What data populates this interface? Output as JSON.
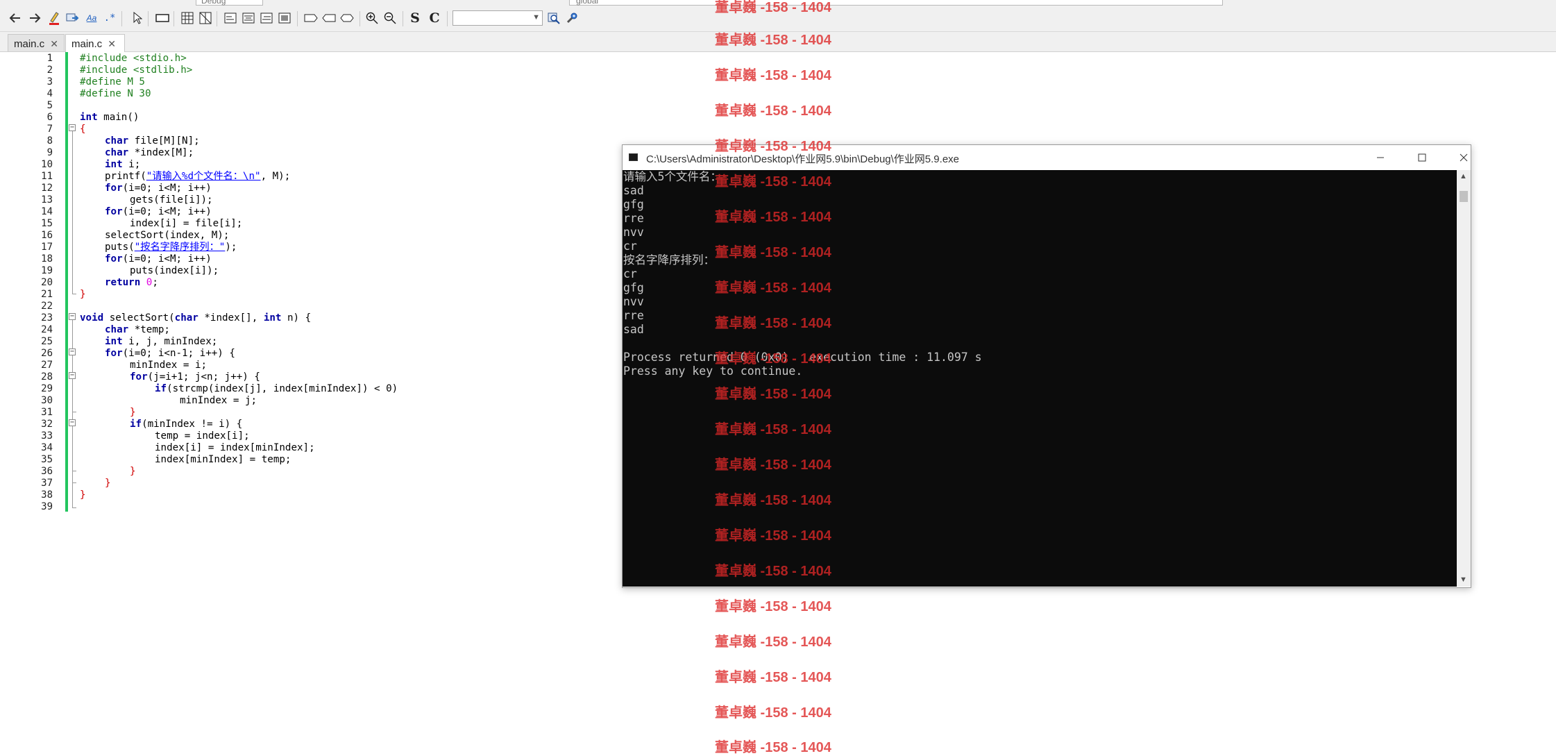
{
  "top_strip": {
    "combo_text": "Debug",
    "scope_text": "global"
  },
  "tabs": [
    {
      "label": "main.c",
      "active": false
    },
    {
      "label": "main.c",
      "active": true
    }
  ],
  "tab_close_glyph": "✕",
  "toolbar": {
    "search_value": "",
    "strike_letter_s": "S",
    "strike_letter_c": "C",
    "icons": [
      "arrow-left-icon",
      "arrow-right-icon",
      "highlight-icon",
      "replace-icon",
      "match-case-icon",
      "regex-icon",
      "pointer-icon",
      "rectangle-icon",
      "table-icon",
      "grid-icon",
      "align-left-icon",
      "align-center-icon",
      "align-right-icon",
      "align-justify-icon",
      "box-icon",
      "box-left-icon",
      "box-right-icon",
      "zoom-in-icon",
      "zoom-out-icon",
      "search-icon",
      "wrench-icon"
    ]
  },
  "editor": {
    "line_numbers": [
      "1",
      "2",
      "3",
      "4",
      "5",
      "6",
      "7",
      "8",
      "9",
      "10",
      "11",
      "12",
      "13",
      "14",
      "15",
      "16",
      "17",
      "18",
      "19",
      "20",
      "21",
      "22",
      "23",
      "24",
      "25",
      "26",
      "27",
      "28",
      "29",
      "30",
      "31",
      "32",
      "33",
      "34",
      "35",
      "36",
      "37",
      "38",
      "39"
    ],
    "code": {
      "l1": "#include <stdio.h>",
      "l2": "#include <stdlib.h>",
      "l3": "#define M 5",
      "l4": "#define N 30",
      "l6_kw": "int",
      "l6_rest": " main()",
      "l7": "{",
      "l8_kw": "char",
      "l8_rest": " file[M][N];",
      "l9_kw": "char",
      "l9_rest": " *index[M];",
      "l10_kw": "int",
      "l10_rest": " i;",
      "l11_a": "printf(",
      "l11_str": "\"请输入%d个文件名：\\n\"",
      "l11_b": ", M);",
      "l12_kw": "for",
      "l12_rest": "(i=0; i<M; i++)",
      "l13": "gets(file[i]);",
      "l14_kw": "for",
      "l14_rest": "(i=0; i<M; i++)",
      "l15": "index[i] = file[i];",
      "l16": "selectSort(index, M);",
      "l17_a": "puts(",
      "l17_str": "\"按名字降序排列：\"",
      "l17_b": ");",
      "l18_kw": "for",
      "l18_rest": "(i=0; i<M; i++)",
      "l19": "puts(index[i]);",
      "l20_kw": "return",
      "l20_num": "0",
      "l20_rest": ";",
      "l21": "}",
      "l23_kw1": "void",
      "l23_a": " selectSort(",
      "l23_kw2": "char",
      "l23_b": " *index[], ",
      "l23_kw3": "int",
      "l23_c": " n) {",
      "l24_kw": "char",
      "l24_rest": " *temp;",
      "l25_kw": "int",
      "l25_rest": " i, j, minIndex;",
      "l26_kw": "for",
      "l26_rest": "(i=0; i<n-1; i++) {",
      "l27": "minIndex = i;",
      "l28_kw": "for",
      "l28_rest": "(j=i+1; j<n; j++) {",
      "l29_kw": "if",
      "l29_rest": "(strcmp(index[j], index[minIndex]) < 0)",
      "l30": "minIndex = j;",
      "l31": "}",
      "l32_kw": "if",
      "l32_rest": "(minIndex != i) {",
      "l33": "temp = index[i];",
      "l34": "index[i] = index[minIndex];",
      "l35": "index[minIndex] = temp;",
      "l36": "}",
      "l37": "}",
      "l38": "}"
    }
  },
  "console": {
    "title": "C:\\Users\\Administrator\\Desktop\\作业网5.9\\bin\\Debug\\作业网5.9.exe",
    "lines": [
      "请输入5个文件名：",
      "sad",
      "gfg",
      "rre",
      "nvv",
      "cr",
      "按名字降序排列：",
      "cr",
      "gfg",
      "nvv",
      "rre",
      "sad",
      "",
      "Process returned 0 (0x0)   execution time : 11.097 s",
      "Press any key to continue."
    ]
  },
  "watermark": {
    "text": "董卓巍 -158 - 1404"
  }
}
